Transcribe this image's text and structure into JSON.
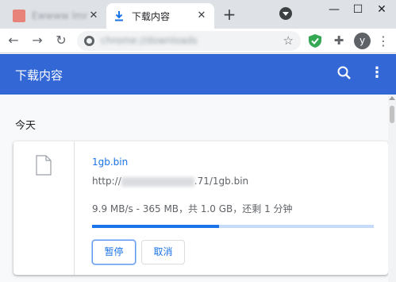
{
  "browser": {
    "tabs": [
      {
        "title": "Ewwww lmrd",
        "close_glyph": "✕"
      },
      {
        "title": "下载内容",
        "close_glyph": "✕"
      }
    ],
    "new_tab_glyph": "+",
    "window_controls": {
      "minimize": "—",
      "maximize": "☐",
      "close": "✕"
    },
    "nav": {
      "back": "←",
      "forward": "→",
      "reload": "↻"
    },
    "address": {
      "url": "chrome://downloads",
      "star": "☆"
    },
    "avatar_letter": "y",
    "menu_glyph": "⋮",
    "puzzle_glyph": "✚"
  },
  "downloads": {
    "header_title": "下载内容",
    "more_glyph": "⋮",
    "date_group": "今天",
    "items": [
      {
        "filename": "1gb.bin",
        "url_prefix": "http://",
        "url_suffix": ".71/1gb.bin",
        "status": "9.9 MB/s - 365 MB，共 1.0 GB，还剩 1 分钟",
        "progress_fraction": 0.45,
        "pause_label": "暂停",
        "cancel_label": "取消"
      }
    ]
  },
  "colors": {
    "header_bg": "#3367d6",
    "accent": "#1a73e8",
    "shield_green": "#34a853"
  },
  "icons": [
    "download-icon",
    "chrome-icon",
    "star-icon",
    "shield-icon",
    "puzzle-icon",
    "search-icon",
    "file-icon"
  ]
}
